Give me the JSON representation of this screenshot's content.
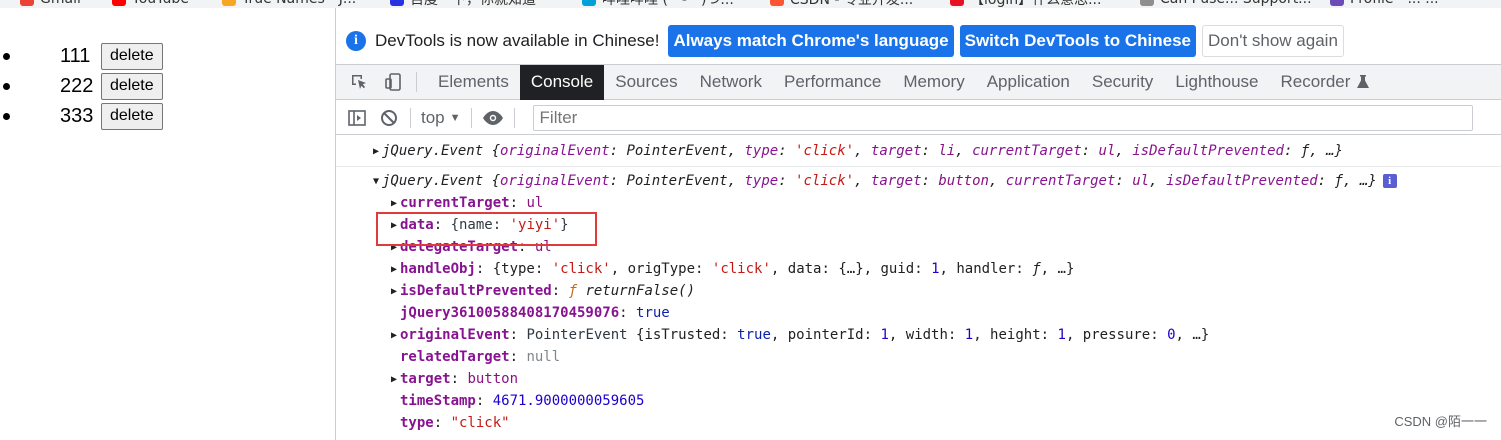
{
  "bookmarks": [
    {
      "label": "Gmail",
      "color": "#ea4335"
    },
    {
      "label": "YouTube",
      "color": "#ff0000"
    },
    {
      "label": "True Names - J...",
      "color": "#f6a623"
    },
    {
      "label": "百度一下，你就知道",
      "color": "#2932e1"
    },
    {
      "label": "哔哩哔哩 (゜-゜)つ...",
      "color": "#00a1d6"
    },
    {
      "label": "CSDN - 专业开发...",
      "color": "#fc5531"
    },
    {
      "label": "【login】什么意思...",
      "color": "#e81123"
    },
    {
      "label": "Can I use... Support...",
      "color": "#8e8e8e"
    },
    {
      "label": "Profile - ... ...",
      "color": "#6a4bb8"
    }
  ],
  "page_list": [
    {
      "text": "111",
      "button": "delete"
    },
    {
      "text": "222",
      "button": "delete"
    },
    {
      "text": "333",
      "button": "delete"
    }
  ],
  "infobar": {
    "message": "DevTools is now available in Chinese!",
    "btn_match": "Always match Chrome's language",
    "btn_switch": "Switch DevTools to Chinese",
    "btn_dismiss": "Don't show again"
  },
  "tabs": [
    "Elements",
    "Console",
    "Sources",
    "Network",
    "Performance",
    "Memory",
    "Application",
    "Security",
    "Lighthouse",
    "Recorder"
  ],
  "active_tab": "Console",
  "toolbar": {
    "context": "top",
    "filter_placeholder": "Filter"
  },
  "console": {
    "line1": {
      "type": "jQuery.Event",
      "summary_pre": " {",
      "originalEvent_key": "originalEvent",
      "originalEvent_val": "PointerEvent",
      "type_key": "type",
      "type_val": "'click'",
      "target_key": "target",
      "target_val": "li",
      "currentTarget_key": "currentTarget",
      "currentTarget_val": "ul",
      "isDefault_key": "isDefaultPrevented",
      "isDefault_val": "ƒ",
      "tail": ", …}"
    },
    "line2": {
      "type": "jQuery.Event",
      "target_val": "button"
    },
    "props": {
      "currentTarget": {
        "key": "currentTarget",
        "val": "ul"
      },
      "data": {
        "key": "data",
        "val_pre": "{name: ",
        "val_str": "'yiyi'",
        "val_post": "}"
      },
      "delegateTarget": {
        "key": "delegateTarget",
        "val": "ul"
      },
      "handleObj": {
        "key": "handleObj",
        "type_val": "'click'",
        "origType_val": "'click'",
        "guid_val": "1"
      },
      "isDefaultPrevented": {
        "key": "isDefaultPrevented",
        "val": "returnFalse()"
      },
      "jQueryId": {
        "key": "jQuery36100588408170459076",
        "val": "true"
      },
      "originalEvent": {
        "key": "originalEvent",
        "val_type": "PointerEvent",
        "isTrusted": "true",
        "pointerId": "1",
        "width": "1",
        "height": "1",
        "pressure": "0"
      },
      "relatedTarget": {
        "key": "relatedTarget",
        "val": "null"
      },
      "target": {
        "key": "target",
        "val": "button"
      },
      "timeStamp": {
        "key": "timeStamp",
        "val": "4671.9000000059605"
      },
      "type": {
        "key": "type",
        "val": "\"click\""
      }
    }
  },
  "watermark": "CSDN @陌一一",
  "colors": {
    "accent": "#1a73e8",
    "highlight": "#e03a3a",
    "active_tab_bg": "#202124"
  }
}
